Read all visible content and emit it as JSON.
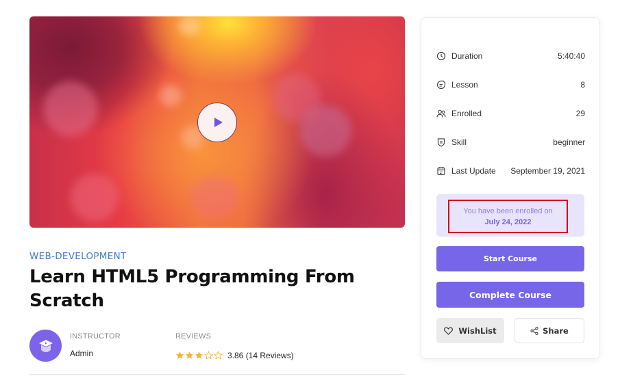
{
  "video": {
    "play_label": "Play video"
  },
  "course": {
    "category": "WEB-DEVELOPMENT",
    "title": "Learn HTML5 Programming From Scratch",
    "instructor_label": "INSTRUCTOR",
    "instructor_name": "Admin",
    "reviews_label": "REVIEWS",
    "rating": 3.86,
    "rating_text": "3.86 (14 Reviews)",
    "stars_filled": 3,
    "stars_total": 5,
    "star_color": "#f5b532"
  },
  "sidebar": {
    "info": [
      {
        "icon": "clock-icon",
        "label": "Duration",
        "value": "5:40:40"
      },
      {
        "icon": "lesson-icon",
        "label": "Lesson",
        "value": "8"
      },
      {
        "icon": "users-icon",
        "label": "Enrolled",
        "value": "29"
      },
      {
        "icon": "shield-icon",
        "label": "Skill",
        "value": "beginner"
      },
      {
        "icon": "calendar-icon",
        "label": "Last Update",
        "value": "September 19, 2021"
      }
    ],
    "enrolled_text": "You have been enrolled on",
    "enrolled_date": "July 24, 2022",
    "start_course": "Start Course",
    "complete_course": "Complete Course",
    "wishlist": "WishList",
    "share": "Share",
    "accent_color": "#7866e8"
  }
}
